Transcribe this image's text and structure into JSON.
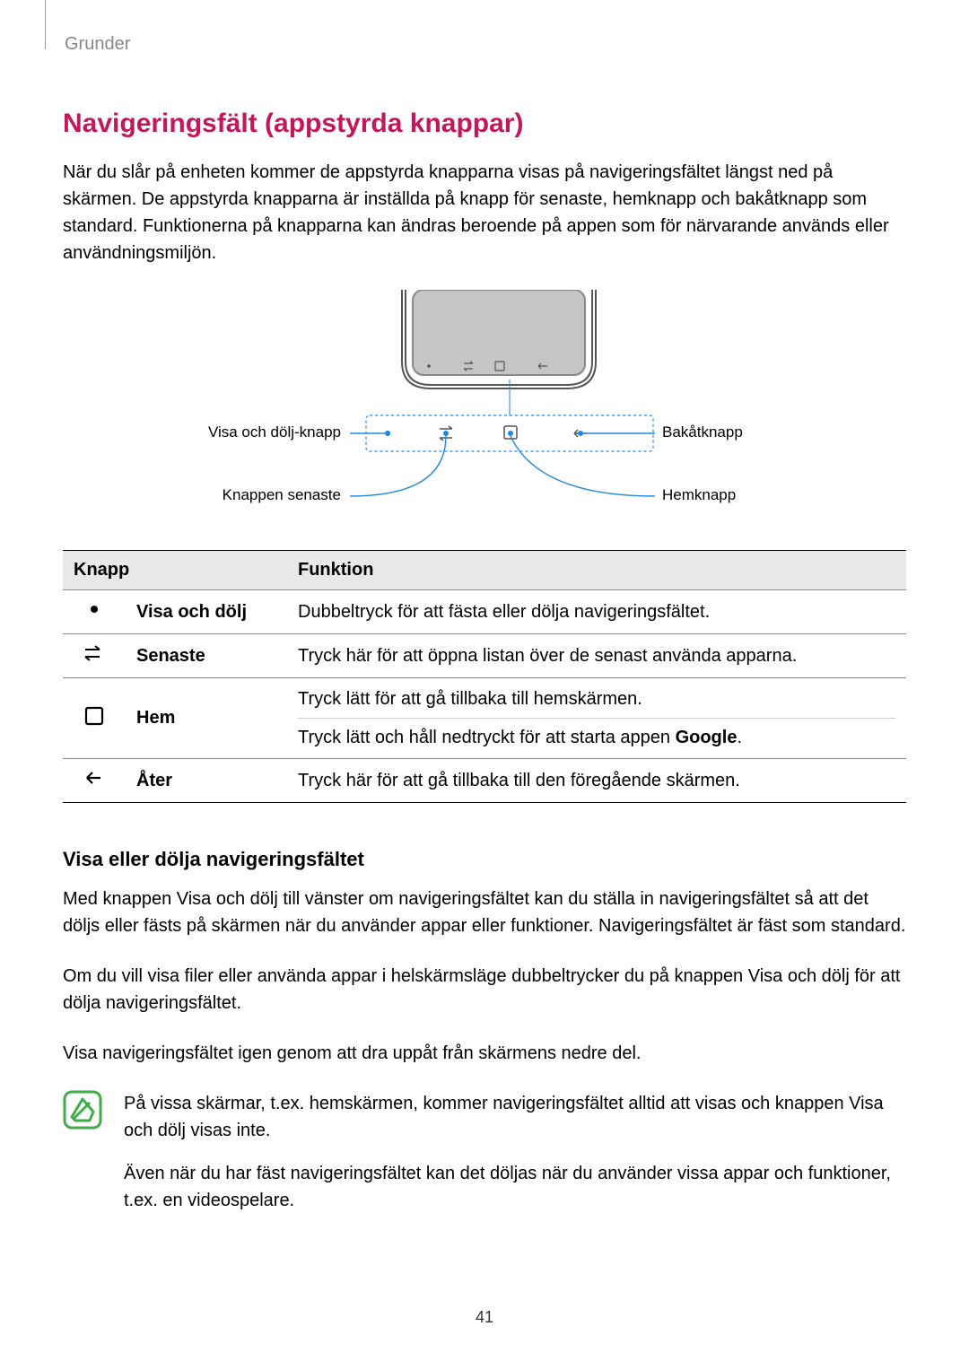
{
  "breadcrumb": "Grunder",
  "page_number": "41",
  "heading": "Navigeringsfält (appstyrda knappar)",
  "intro": "När du slår på enheten kommer de appstyrda knapparna visas på navigeringsfältet längst ned på skärmen. De appstyrda knapparna är inställda på knapp för senaste, hemknapp och bakåtknapp som standard. Funktionerna på knapparna kan ändras beroende på appen som för närvarande används eller användningsmiljön.",
  "figure_labels": {
    "show_hide": "Visa och dölj-knapp",
    "recents": "Knappen senaste",
    "back": "Bakåtknapp",
    "home": "Hemknapp"
  },
  "table": {
    "headers": {
      "button": "Knapp",
      "function": "Funktion"
    },
    "rows": [
      {
        "icon": "dot",
        "name": "Visa och dölj",
        "func": "Dubbeltryck för att fästa eller dölja navigeringsfältet."
      },
      {
        "icon": "recents",
        "name": "Senaste",
        "func": "Tryck här för att öppna listan över de senast använda apparna."
      },
      {
        "icon": "home",
        "name": "Hem",
        "func1": "Tryck lätt för att gå tillbaka till hemskärmen.",
        "func2_pre": "Tryck lätt och håll nedtryckt för att starta appen ",
        "func2_bold": "Google",
        "func2_post": "."
      },
      {
        "icon": "back",
        "name": "Åter",
        "func": "Tryck här för att gå tillbaka till den föregående skärmen."
      }
    ]
  },
  "section2": {
    "heading": "Visa eller dölja navigeringsfältet",
    "p1": "Med knappen Visa och dölj till vänster om navigeringsfältet kan du ställa in navigeringsfältet så att det döljs eller fästs på skärmen när du använder appar eller funktioner. Navigeringsfältet är fäst som standard.",
    "p2": "Om du vill visa filer eller använda appar i helskärmsläge dubbeltrycker du på knappen Visa och dölj för att dölja navigeringsfältet.",
    "p3": "Visa navigeringsfältet igen genom att dra uppåt från skärmens nedre del."
  },
  "notes": {
    "n1": "På vissa skärmar, t.ex. hemskärmen, kommer navigeringsfältet alltid att visas och knappen Visa och dölj visas inte.",
    "n2": "Även när du har fäst navigeringsfältet kan det döljas när du använder vissa appar och funktioner, t.ex. en videospelare."
  }
}
